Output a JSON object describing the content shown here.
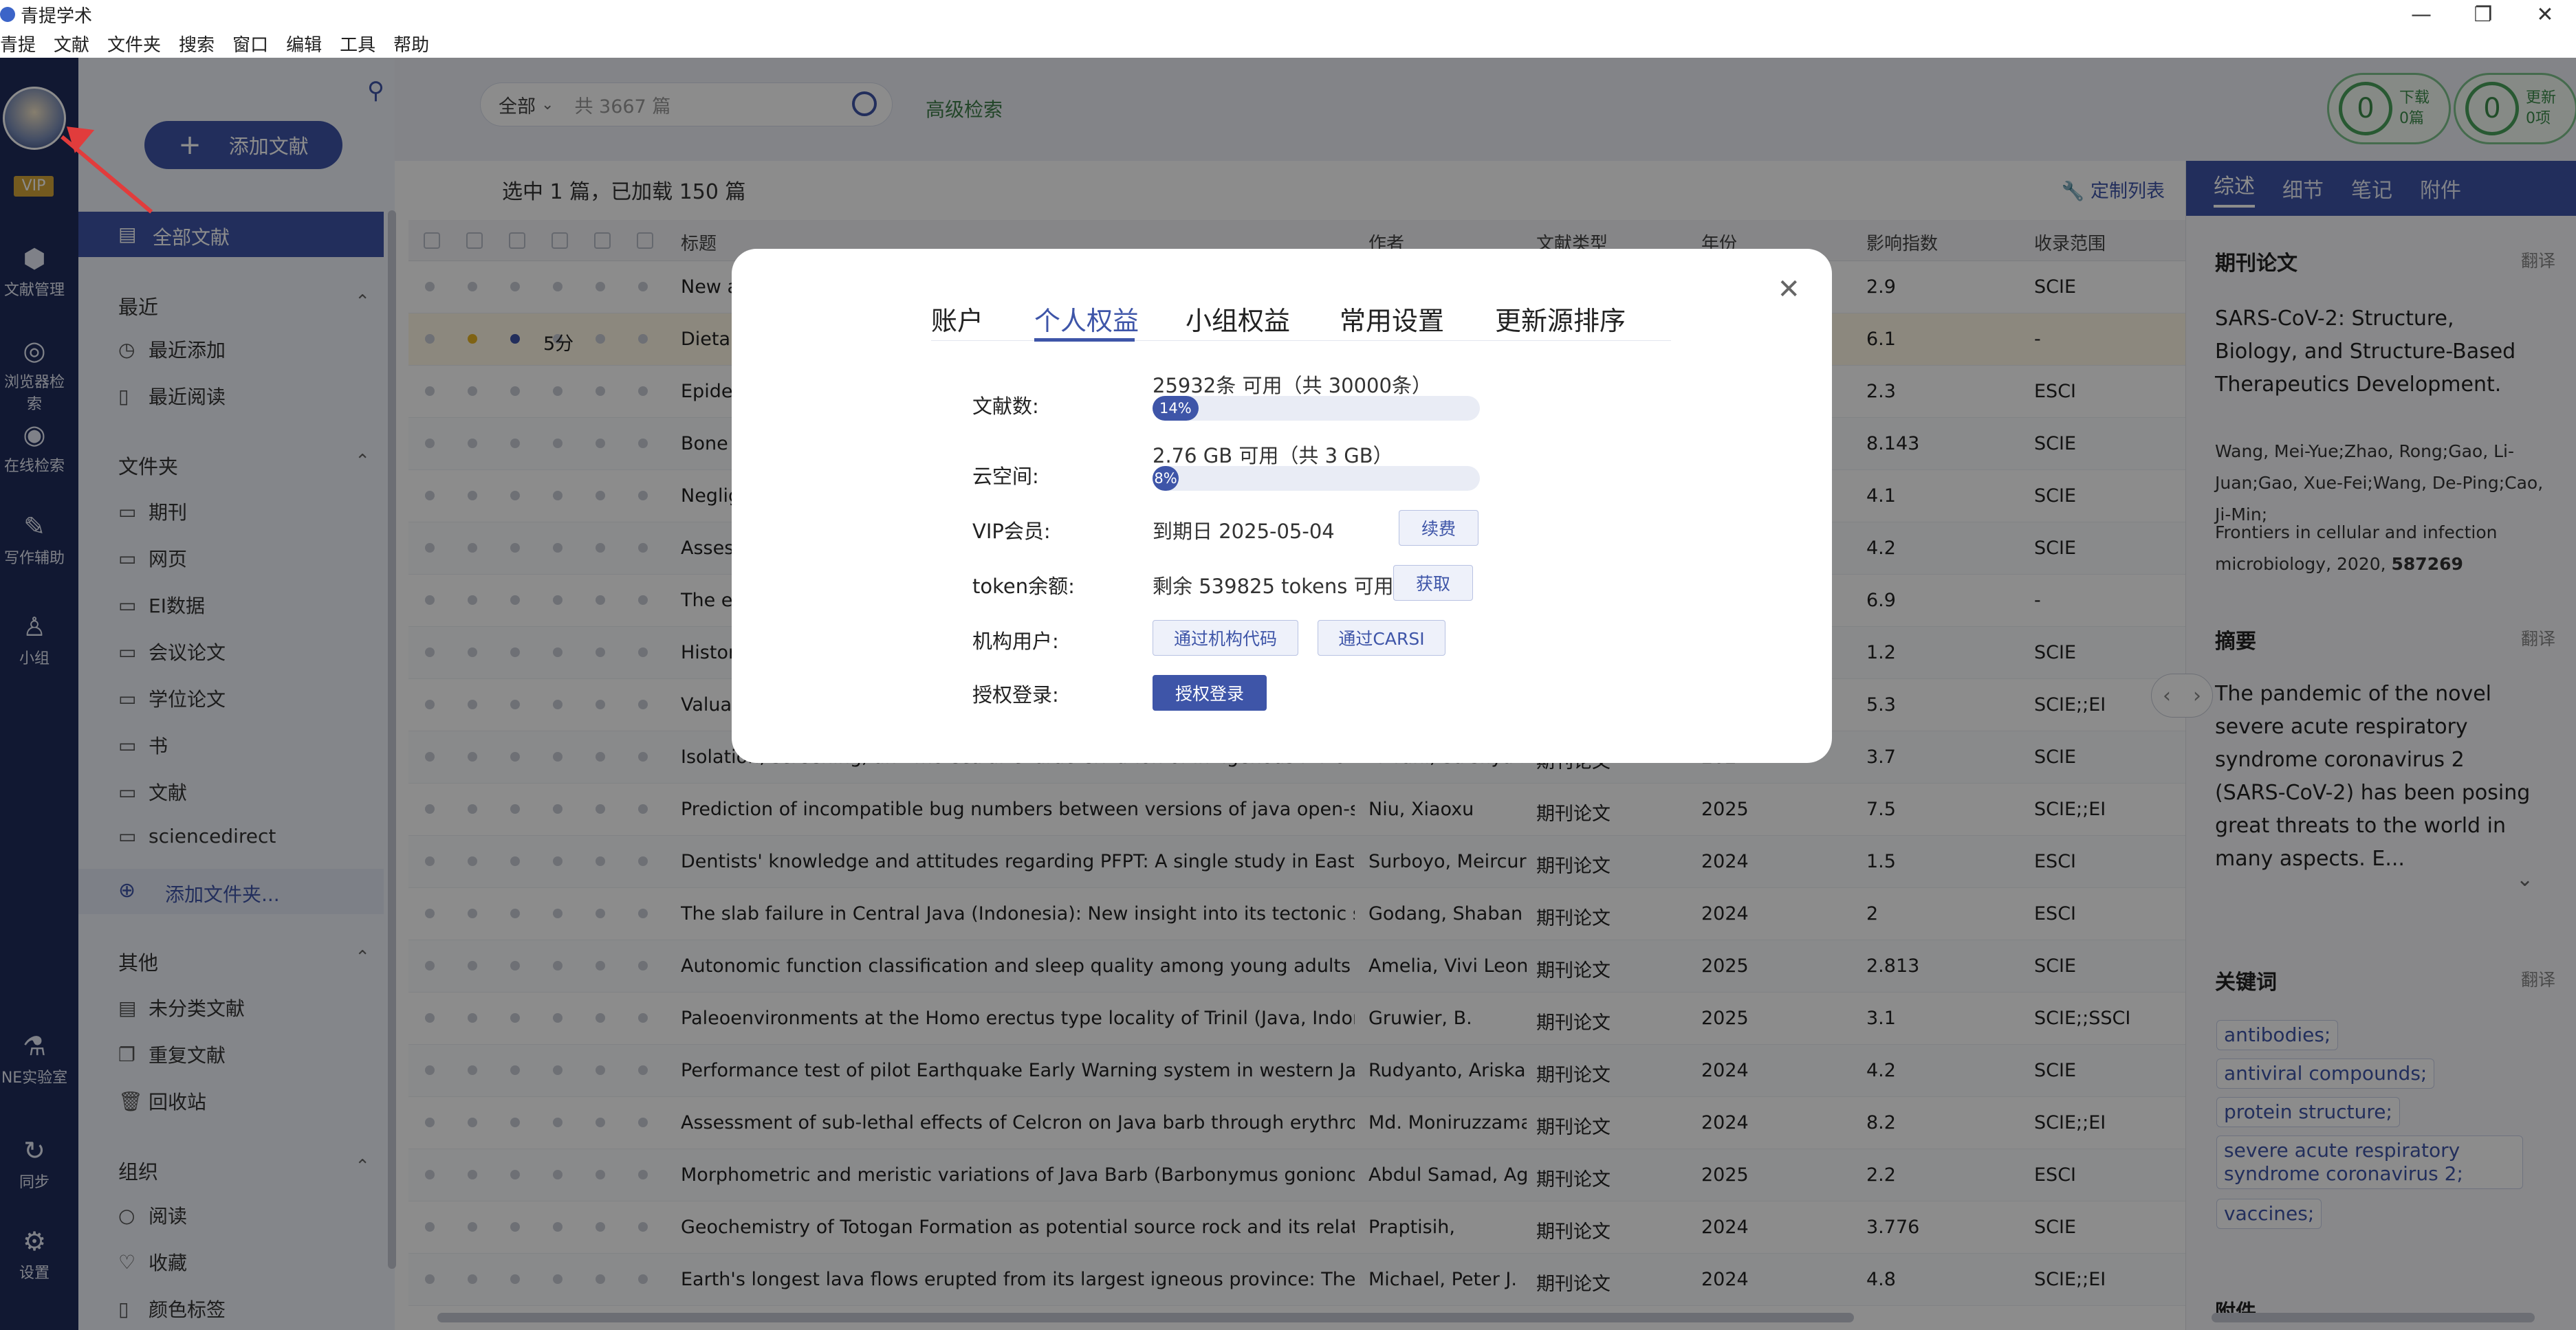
{
  "app": {
    "title": "青提学术"
  },
  "menu": [
    "青提",
    "文献",
    "文件夹",
    "搜索",
    "窗口",
    "编辑",
    "工具",
    "帮助"
  ],
  "rail": {
    "vip": "VIP",
    "items": [
      "文献管理",
      "浏览器检索",
      "在线检索",
      "写作辅助",
      "小组",
      "NE实验室",
      "同步",
      "设置"
    ]
  },
  "sidebar": {
    "add_button": "添加文献",
    "all": "全部文献",
    "recent_head": "最近",
    "recent": [
      "最近添加",
      "最近阅读"
    ],
    "folders_head": "文件夹",
    "folders": [
      "期刊",
      "网页",
      "EI数据",
      "会议论文",
      "学位论文",
      "书",
      "文献",
      "sciencedirect"
    ],
    "add_folder": "添加文件夹...",
    "other_head": "其他",
    "other": [
      "未分类文献",
      "重复文献",
      "回收站"
    ],
    "org_head": "组织",
    "org": [
      "阅读",
      "收藏",
      "颜色标签"
    ]
  },
  "search": {
    "scope": "全部",
    "count": "共 3667 篇",
    "advanced": "高级检索"
  },
  "counters": [
    {
      "value": "0",
      "label1": "下载",
      "label2": "0篇"
    },
    {
      "value": "0",
      "label1": "更新",
      "label2": "0项"
    }
  ],
  "list": {
    "info": "选中 1 篇，已加载 150 篇",
    "custom": "定制列表",
    "headers": {
      "title": "标题",
      "author": "作者",
      "type": "文献类型",
      "year": "年份",
      "impact": "影响指数",
      "scope": "收录范围"
    },
    "rows": [
      {
        "title": "New a",
        "author": "",
        "type": "",
        "year": "",
        "impact": "2.9",
        "scope": "SCIE"
      },
      {
        "title": "Dietary",
        "author": "",
        "type": "",
        "year": "",
        "impact": "6.1",
        "scope": "-",
        "score": "5分"
      },
      {
        "title": "Epiden",
        "author": "",
        "type": "",
        "year": "",
        "impact": "2.3",
        "scope": "ESCI"
      },
      {
        "title": "Bone r",
        "author": "",
        "type": "",
        "year": "",
        "impact": "8.143",
        "scope": "SCIE"
      },
      {
        "title": "Neglig",
        "author": "",
        "type": "",
        "year": "",
        "impact": "4.1",
        "scope": "SCIE"
      },
      {
        "title": "Assess",
        "author": "",
        "type": "",
        "year": "",
        "impact": "4.2",
        "scope": "SCIE"
      },
      {
        "title": "The ec",
        "author": "",
        "type": "",
        "year": "",
        "impact": "6.9",
        "scope": "-"
      },
      {
        "title": "Histori",
        "author": "",
        "type": "",
        "year": "",
        "impact": "1.2",
        "scope": "SCIE"
      },
      {
        "title": "Valuati",
        "author": "",
        "type": "",
        "year": "",
        "impact": "5.3",
        "scope": "SCIE;;EI"
      },
      {
        "title": "Isolation, screening, and molecular characterization of indigenous rhizobacteria isolat",
        "author": "Fikrani, Salsfiya Ika",
        "type": "期刊论文",
        "year": "2024",
        "impact": "3.7",
        "scope": "SCIE"
      },
      {
        "title": "Prediction of incompatible bug numbers between versions of java open-source softw",
        "author": "Niu, Xiaoxu",
        "type": "期刊论文",
        "year": "2025",
        "impact": "7.5",
        "scope": "SCIE;;EI"
      },
      {
        "title": "Dentists' knowledge and attitudes regarding PFPT: A single study in East Java, Indone",
        "author": "Surboyo, Meircuriu",
        "type": "期刊论文",
        "year": "2024",
        "impact": "1.5",
        "scope": "ESCI"
      },
      {
        "title": "The slab failure in Central Java (Indonesia): New insight into its tectonic setting and oi",
        "author": "Godang, Shaban",
        "type": "期刊论文",
        "year": "2024",
        "impact": "2",
        "scope": "ESCI"
      },
      {
        "title": "Autonomic function classification and sleep quality among young adults in Central Jav",
        "author": "Amelia, Vivi Leona",
        "type": "期刊论文",
        "year": "2025",
        "impact": "2.813",
        "scope": "SCIE"
      },
      {
        "title": "Paleoenvironments at the Homo erectus type locality of Trinil (Java, Indonesia): The ar",
        "author": "Gruwier, B.",
        "type": "期刊论文",
        "year": "2025",
        "impact": "3.1",
        "scope": "SCIE;;SSCI"
      },
      {
        "title": "Performance test of pilot Earthquake Early Warning system in western Java, Indonesia",
        "author": "Rudyanto, Ariska",
        "type": "期刊论文",
        "year": "2024",
        "impact": "4.2",
        "scope": "SCIE"
      },
      {
        "title": "Assessment of sub-lethal effects of Celcron on Java barb through erythrocyte morphc",
        "author": "Md. Moniruzzaman",
        "type": "期刊论文",
        "year": "2024",
        "impact": "8.2",
        "scope": "SCIE;;EI"
      },
      {
        "title": "Morphometric and meristic variations of Java Barb (Barbonymus gonionotus) in six di:",
        "author": "Abdul Samad, Agus",
        "type": "期刊论文",
        "year": "2025",
        "impact": "2.2",
        "scope": "ESCI"
      },
      {
        "title": "Geochemistry of Totogan Formation as potential source rock and its relationship with",
        "author": "Praptisih,",
        "type": "期刊论文",
        "year": "2024",
        "impact": "3.776",
        "scope": "SCIE"
      },
      {
        "title": "Earth's longest lava flows erupted from its largest igneous province: The submarine O",
        "author": "Michael, Peter J.",
        "type": "期刊论文",
        "year": "2024",
        "impact": "4.8",
        "scope": "SCIE;;EI"
      }
    ]
  },
  "rpanel": {
    "tabs": [
      "综述",
      "细节",
      "笔记",
      "附件"
    ],
    "type_head": "期刊论文",
    "translate": "翻译",
    "title": "SARS-CoV-2: Structure, Biology, and Structure-Based Therapeutics Development.",
    "authors": "Wang, Mei-Yue;Zhao, Rong;Gao, Li-Juan;Gao, Xue-Fei;Wang, De-Ping;Cao, Ji-Min;",
    "journal": "Frontiers in cellular and infection microbiology, 2020,",
    "journal_num": "587269",
    "abstract_head": "摘要",
    "abstract": "The pandemic of the novel severe acute respiratory syndrome coronavirus 2 (SARS-CoV-2) has been posing great threats to the world in many aspects. E...",
    "keywords_head": "关键词",
    "keywords": [
      "antibodies;",
      "antiviral compounds;",
      "protein structure;",
      "severe acute respiratory syndrome coronavirus 2;",
      "vaccines;"
    ],
    "attach_head": "附件"
  },
  "modal": {
    "tabs": [
      "账户",
      "个人权益",
      "小组权益",
      "常用设置",
      "更新源排序"
    ],
    "docs_label": "文献数:",
    "docs_value": "25932条 可用（共 30000条）",
    "docs_pct": 14,
    "docs_pct_text": "14%",
    "cloud_label": "云空间:",
    "cloud_value": "2.76 GB 可用（共 3 GB）",
    "cloud_pct": 8,
    "cloud_pct_text": "8%",
    "vip_label": "VIP会员:",
    "vip_value": "到期日 2025-05-04",
    "renew": "续费",
    "token_label": "token余额:",
    "token_value": "剩余 539825 tokens 可用",
    "get": "获取",
    "inst_label": "机构用户:",
    "inst_code": "通过机构代码",
    "inst_carsi": "通过CARSI",
    "auth_label": "授权登录:",
    "auth_btn": "授权登录"
  }
}
